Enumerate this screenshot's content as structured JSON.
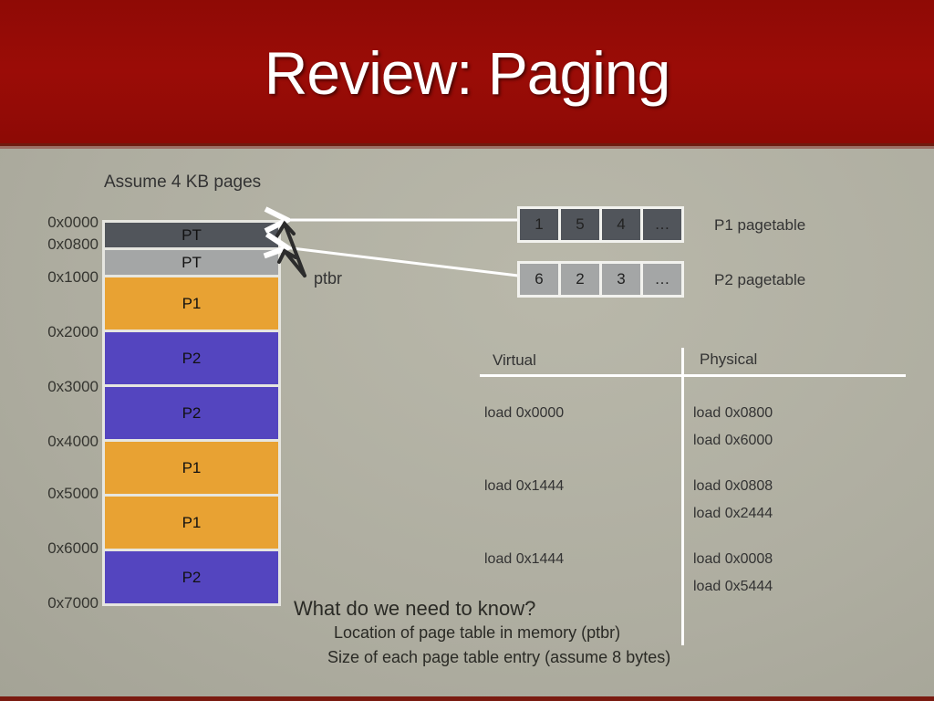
{
  "slide": {
    "title": "Review: Paging",
    "assumption": "Assume 4 KB pages"
  },
  "memory": {
    "addresses": [
      "0x0000",
      "0x0800",
      "0x1000",
      "0x2000",
      "0x3000",
      "0x4000",
      "0x5000",
      "0x6000",
      "0x7000"
    ],
    "blocks": [
      {
        "label": "PT",
        "color": "#51555b"
      },
      {
        "label": "PT",
        "color": "#a4a6a6"
      },
      {
        "label": "P1",
        "color": "#e8a233"
      },
      {
        "label": "P2",
        "color": "#5445bf"
      },
      {
        "label": "P2",
        "color": "#5445bf"
      },
      {
        "label": "P1",
        "color": "#e8a233"
      },
      {
        "label": "P1",
        "color": "#e8a233"
      },
      {
        "label": "P2",
        "color": "#5445bf"
      }
    ]
  },
  "ptbr_label": "ptbr",
  "pagetables": [
    {
      "entries": [
        "1",
        "5",
        "4",
        "…"
      ],
      "label": "P1 pagetable",
      "color": "#51555b"
    },
    {
      "entries": [
        "6",
        "2",
        "3",
        "…"
      ],
      "label": "P2 pagetable",
      "color": "#a4a6a6"
    }
  ],
  "translation": {
    "virtual_header": "Virtual",
    "physical_header": "Physical",
    "virtual": [
      "load 0x0000",
      "load 0x1444",
      "load 0x1444"
    ],
    "physical": [
      "load 0x0800",
      "load 0x6000",
      "load 0x0808",
      "load 0x2444",
      "load 0x0008",
      "load 0x5444"
    ]
  },
  "notes": {
    "question": "What do we need to know?",
    "bullets": [
      "Location of page table in memory (ptbr)",
      "Size of each page table entry (assume 8 bytes)"
    ]
  }
}
